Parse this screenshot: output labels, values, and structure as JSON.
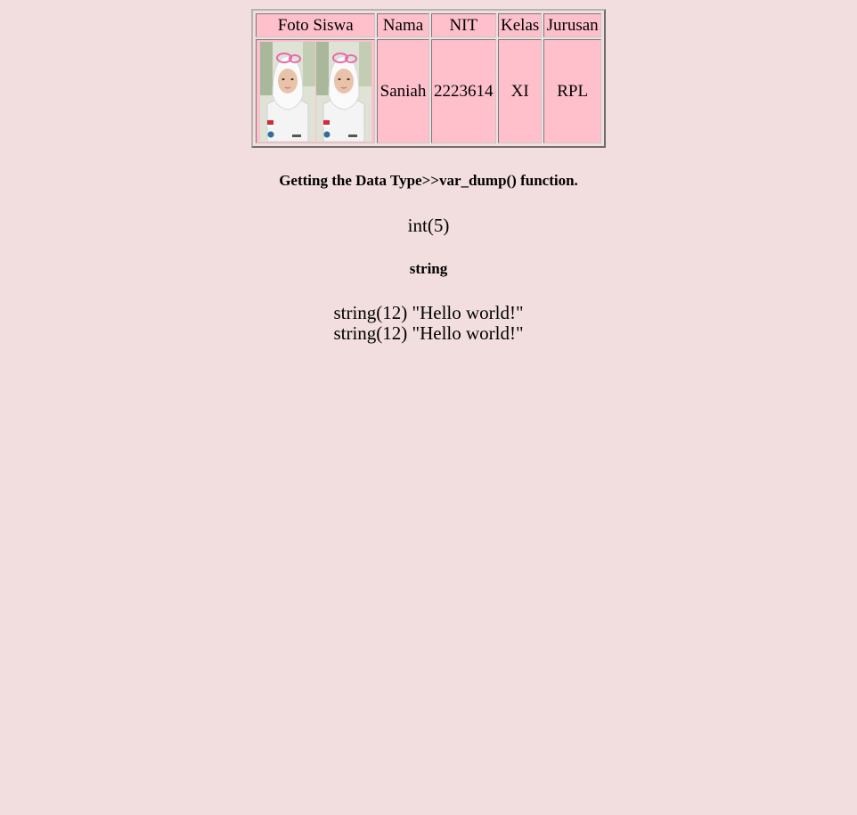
{
  "table": {
    "headers": [
      "Foto Siswa",
      "Nama",
      "NIT",
      "Kelas",
      "Jurusan"
    ],
    "row": {
      "nama": "Saniah",
      "nit": "2223614",
      "kelas": "XI",
      "jurusan": "RPL"
    }
  },
  "output": {
    "heading_1": "Getting the Data Type>>var_dump() function.",
    "line_1": "int(5)",
    "heading_2": "string",
    "line_2": "string(12) \"Hello world!\"",
    "line_3": "string(12) \"Hello world!\""
  },
  "colors": {
    "page_background": "#f2dede",
    "cell_background": "#ffc0cb"
  }
}
